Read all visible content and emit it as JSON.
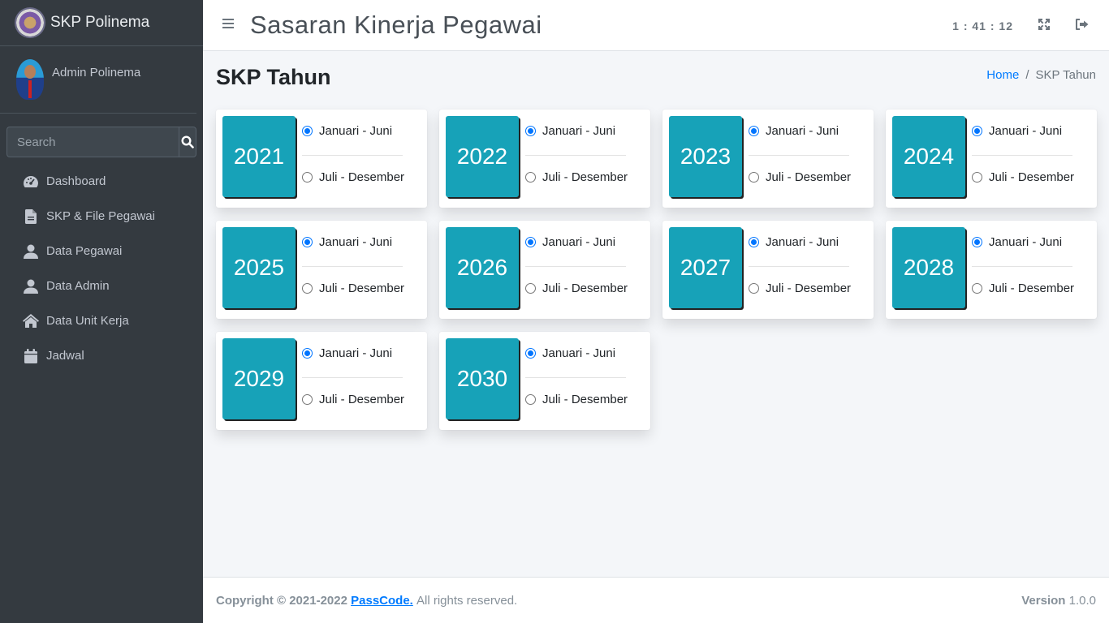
{
  "sidebar": {
    "brand": "SKP Polinema",
    "user_name": "Admin Polinema",
    "search_placeholder": "Search",
    "items": [
      {
        "label": "Dashboard",
        "icon": "tachometer-icon"
      },
      {
        "label": "SKP & File Pegawai",
        "icon": "file-icon"
      },
      {
        "label": "Data Pegawai",
        "icon": "user-icon"
      },
      {
        "label": "Data Admin",
        "icon": "user-icon"
      },
      {
        "label": "Data Unit Kerja",
        "icon": "home-icon"
      },
      {
        "label": "Jadwal",
        "icon": "calendar-icon"
      }
    ]
  },
  "header": {
    "title": "Sasaran Kinerja Pegawai",
    "clock": "1 : 41 : 12"
  },
  "content": {
    "page_title": "SKP Tahun",
    "breadcrumb_home": "Home",
    "breadcrumb_current": "SKP Tahun"
  },
  "years": [
    {
      "year": "2021",
      "opt1": "Januari - Juni",
      "opt2": "Juli - Desember",
      "selected": 1
    },
    {
      "year": "2022",
      "opt1": "Januari - Juni",
      "opt2": "Juli - Desember",
      "selected": 1
    },
    {
      "year": "2023",
      "opt1": "Januari - Juni",
      "opt2": "Juli - Desember",
      "selected": 1
    },
    {
      "year": "2024",
      "opt1": "Januari - Juni",
      "opt2": "Juli - Desember",
      "selected": 1
    },
    {
      "year": "2025",
      "opt1": "Januari - Juni",
      "opt2": "Juli - Desember",
      "selected": 1
    },
    {
      "year": "2026",
      "opt1": "Januari - Juni",
      "opt2": "Juli - Desember",
      "selected": 1
    },
    {
      "year": "2027",
      "opt1": "Januari - Juni",
      "opt2": "Juli - Desember",
      "selected": 1
    },
    {
      "year": "2028",
      "opt1": "Januari - Juni",
      "opt2": "Juli - Desember",
      "selected": 1
    },
    {
      "year": "2029",
      "opt1": "Januari - Juni",
      "opt2": "Juli - Desember",
      "selected": 1
    },
    {
      "year": "2030",
      "opt1": "Januari - Juni",
      "opt2": "Juli - Desember",
      "selected": 1
    }
  ],
  "footer": {
    "copyright": "Copyright © 2021-2022",
    "brand": "PassCode.",
    "rights": "All rights reserved.",
    "version_label": "Version",
    "version": "1.0.0"
  },
  "colors": {
    "sidebar_bg": "#343a40",
    "year_box": "#17a2b8",
    "link": "#007bff"
  }
}
